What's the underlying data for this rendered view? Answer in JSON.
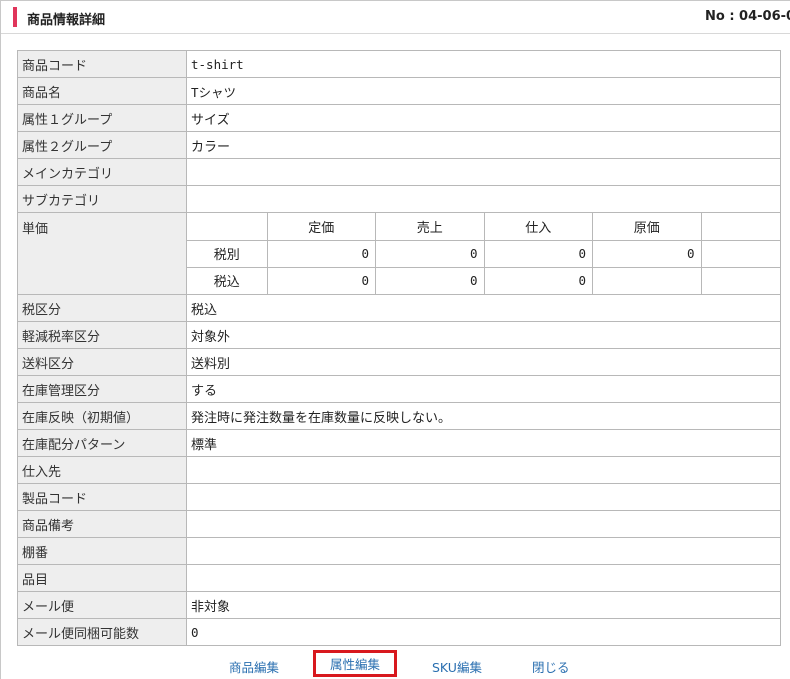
{
  "header": {
    "title": "商品情報詳細",
    "number": "No : 04-06-0"
  },
  "rows_top": [
    {
      "label": "商品コード",
      "value": "t-shirt"
    },
    {
      "label": "商品名",
      "value": "Tシャツ"
    },
    {
      "label": "属性１グループ",
      "value": "サイズ"
    },
    {
      "label": "属性２グループ",
      "value": "カラー"
    },
    {
      "label": "メインカテゴリ",
      "value": ""
    },
    {
      "label": "サブカテゴリ",
      "value": ""
    }
  ],
  "price": {
    "label": "単価",
    "columns": [
      "定価",
      "売上",
      "仕入",
      "原価"
    ],
    "rows": [
      {
        "label": "税別",
        "values": [
          "0",
          "0",
          "0",
          "0"
        ]
      },
      {
        "label": "税込",
        "values": [
          "0",
          "0",
          "0",
          ""
        ]
      }
    ]
  },
  "rows_bottom": [
    {
      "label": "税区分",
      "value": "税込"
    },
    {
      "label": "軽減税率区分",
      "value": "対象外"
    },
    {
      "label": "送料区分",
      "value": "送料別"
    },
    {
      "label": "在庫管理区分",
      "value": "する"
    },
    {
      "label": "在庫反映（初期値）",
      "value": "発注時に発注数量を在庫数量に反映しない。"
    },
    {
      "label": "在庫配分パターン",
      "value": "標準"
    },
    {
      "label": "仕入先",
      "value": ""
    },
    {
      "label": "製品コード",
      "value": ""
    },
    {
      "label": "商品備考",
      "value": ""
    },
    {
      "label": "棚番",
      "value": ""
    },
    {
      "label": "品目",
      "value": ""
    },
    {
      "label": "メール便",
      "value": "非対象"
    },
    {
      "label": "メール便同梱可能数",
      "value": "0"
    }
  ],
  "footer": {
    "edit_product": "商品編集",
    "edit_attribute": "属性編集",
    "edit_sku": "SKU編集",
    "close": "閉じる"
  },
  "colors": {
    "accent": "#e0355b",
    "link": "#2a6fb0",
    "highlight": "#d8181e",
    "label_bg": "#eeeeee"
  }
}
